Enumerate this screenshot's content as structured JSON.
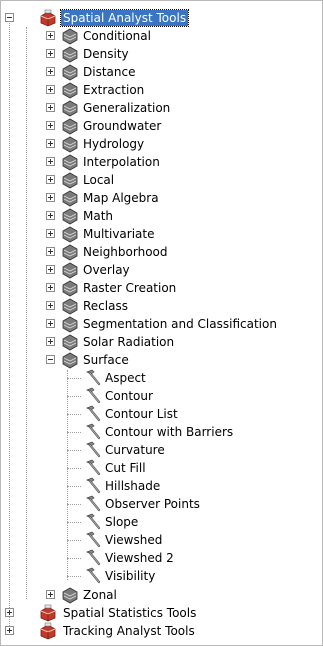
{
  "tree": {
    "root": {
      "label": "Spatial Analyst Tools",
      "expanded": true
    },
    "toolsets": [
      {
        "label": "Conditional"
      },
      {
        "label": "Density"
      },
      {
        "label": "Distance"
      },
      {
        "label": "Extraction"
      },
      {
        "label": "Generalization"
      },
      {
        "label": "Groundwater"
      },
      {
        "label": "Hydrology"
      },
      {
        "label": "Interpolation"
      },
      {
        "label": "Local"
      },
      {
        "label": "Map Algebra"
      },
      {
        "label": "Math"
      },
      {
        "label": "Multivariate"
      },
      {
        "label": "Neighborhood"
      },
      {
        "label": "Overlay"
      },
      {
        "label": "Raster Creation"
      },
      {
        "label": "Reclass"
      },
      {
        "label": "Segmentation and Classification"
      },
      {
        "label": "Solar Radiation"
      }
    ],
    "surface": {
      "label": "Surface",
      "tools": [
        {
          "label": "Aspect"
        },
        {
          "label": "Contour"
        },
        {
          "label": "Contour List"
        },
        {
          "label": "Contour with Barriers"
        },
        {
          "label": "Curvature"
        },
        {
          "label": "Cut Fill"
        },
        {
          "label": "Hillshade"
        },
        {
          "label": "Observer Points"
        },
        {
          "label": "Slope"
        },
        {
          "label": "Viewshed"
        },
        {
          "label": "Viewshed 2"
        },
        {
          "label": "Visibility"
        }
      ]
    },
    "zonal": {
      "label": "Zonal"
    },
    "other_toolboxes": [
      {
        "label": "Spatial Statistics Tools"
      },
      {
        "label": "Tracking Analyst Tools"
      }
    ]
  },
  "colors": {
    "selection": "#3a75c4",
    "toolbox_red": "#c0392b",
    "toolset_gray": "#6b6b6b"
  },
  "icons": {
    "toolbox": "toolbox-icon",
    "toolset": "toolset-icon",
    "tool": "hammer-icon"
  }
}
